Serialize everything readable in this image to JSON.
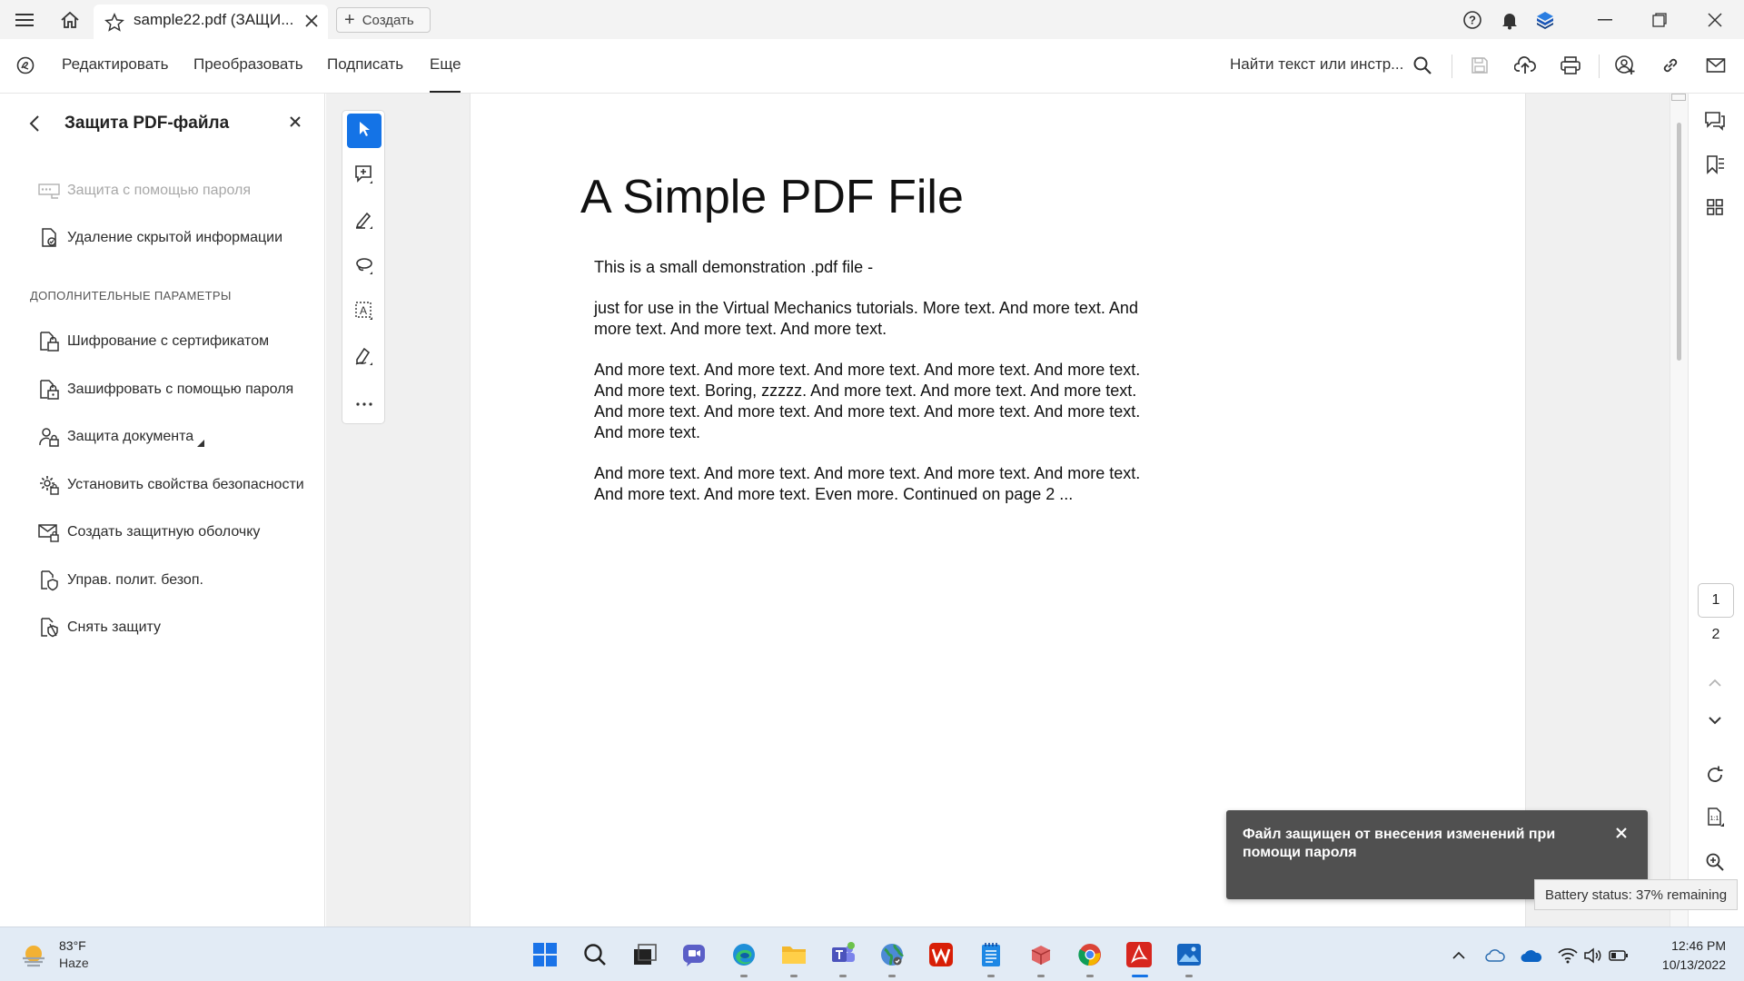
{
  "titlebar": {
    "tab_title": "sample22.pdf (ЗАЩИ...",
    "create_label": "Создать"
  },
  "menubar": {
    "items": [
      "Редактировать",
      "Преобразовать",
      "Подписать",
      "Еще"
    ],
    "active_item": "Еще",
    "search_placeholder": "Найти текст или инстр..."
  },
  "left_panel": {
    "title": "Защита PDF-файла",
    "items": [
      {
        "label": "Защита с помощью пароля",
        "icon": "password-field-icon",
        "disabled": true
      },
      {
        "label": "Удаление скрытой информации",
        "icon": "redact-document-icon",
        "disabled": false
      }
    ],
    "advanced_heading": "ДОПОЛНИТЕЛЬНЫЕ ПАРАМЕТРЫ",
    "advanced_items": [
      {
        "label": "Шифрование с сертификатом",
        "icon": "certificate-lock-icon"
      },
      {
        "label": "Зашифровать с помощью пароля",
        "icon": "password-lock-icon"
      },
      {
        "label": "Защита документа",
        "icon": "user-lock-icon"
      },
      {
        "label": "Установить свойства безопасности",
        "icon": "gear-lock-icon"
      },
      {
        "label": "Создать защитную оболочку",
        "icon": "envelope-lock-icon"
      },
      {
        "label": "Управ. полит. безоп.",
        "icon": "shield-document-icon"
      },
      {
        "label": "Снять защиту",
        "icon": "unlock-shield-icon"
      }
    ]
  },
  "tools": [
    "select-arrow-icon",
    "add-comment-icon",
    "highlight-pen-icon",
    "lasso-icon",
    "text-select-icon",
    "sign-pen-icon",
    "more-tools-icon"
  ],
  "document": {
    "title": "A Simple PDF File",
    "paragraphs": [
      "This is a small demonstration .pdf file -",
      "just for use in the Virtual Mechanics tutorials. More text. And more text. And more text. And more text. And more text.",
      "And more text. And more text. And more text. And more text. And more text. And more text. Boring, zzzzz. And more text. And more text. And more text. And more text. And more text. And more text. And more text. And more text. And more text.",
      "And more text. And more text. And more text. And more text. And more text. And more text. And more text. Even more. Continued on page 2 ..."
    ]
  },
  "page_nav": {
    "pages": [
      "1",
      "2"
    ],
    "current": "1"
  },
  "toast": {
    "message": "Файл защищен от внесения изменений при помощи пароля"
  },
  "battery_tooltip": "Battery status: 37% remaining",
  "taskbar": {
    "weather_temp": "83°F",
    "weather_desc": "Haze",
    "time": "12:46 PM",
    "date": "10/13/2022"
  },
  "colors": {
    "accent": "#1473e6",
    "toast_bg": "#505050",
    "taskbar_bg": "#e2ebf5"
  }
}
